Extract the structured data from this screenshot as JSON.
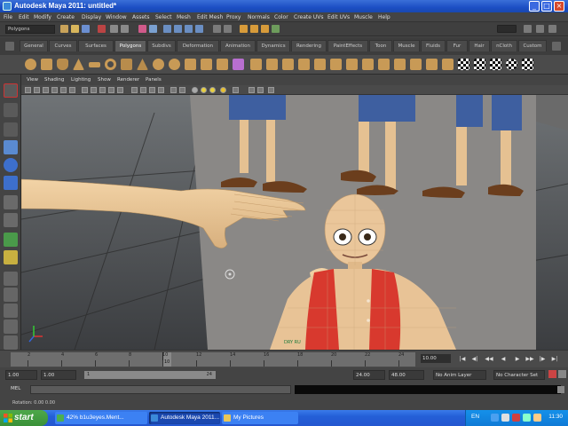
{
  "window": {
    "title": "Autodesk Maya 2011: untitled*"
  },
  "menubar": [
    "File",
    "Edit",
    "Modify",
    "Create",
    "Display",
    "Window",
    "Assets",
    "Select",
    "Mesh",
    "Edit Mesh",
    "Proxy",
    "Normals",
    "Color",
    "Create UVs",
    "Edit UVs",
    "Muscle",
    "Help"
  ],
  "status_line": {
    "mode": "Polygons"
  },
  "shelf_tabs": {
    "items": [
      "General",
      "Curves",
      "Surfaces",
      "Polygons",
      "Subdivs",
      "Deformation",
      "Animation",
      "Dynamics",
      "Rendering",
      "PaintEffects",
      "Toon",
      "Muscle",
      "Fluids",
      "Fur",
      "Hair",
      "nCloth",
      "Custom"
    ],
    "active": "Polygons"
  },
  "panel_menu": [
    "View",
    "Shading",
    "Lighting",
    "Show",
    "Renderer",
    "Panels"
  ],
  "viewport": {
    "mesh_label": "DRY RU"
  },
  "time_slider": {
    "tick_labels": [
      "2",
      "4",
      "6",
      "8",
      "10",
      "12",
      "14",
      "16",
      "18",
      "20",
      "22",
      "24"
    ],
    "current_frame_label": "10",
    "current_frame_field": "10.00",
    "playback_buttons": [
      "|◀",
      "◀|",
      "◀◀",
      "◀",
      "▶",
      "▶▶",
      "|▶",
      "▶|"
    ]
  },
  "range_slider": {
    "start_time": "1.00",
    "playback_start": "1.00",
    "range_start": "1",
    "range_end": "24",
    "playback_end": "24.00",
    "end_time": "48.00",
    "anim_layer": "No Anim Layer",
    "character_set": "No Character Set"
  },
  "command_line": {
    "label": "MEL"
  },
  "help_line": {
    "text": "Rotation:    0.00    0.00"
  },
  "taskbar": {
    "start_label": "start",
    "tasks": [
      {
        "label": "42% b1u3eyes.Ment...",
        "active": false
      },
      {
        "label": "Autodesk Maya 2011...",
        "active": true
      },
      {
        "label": "My Pictures",
        "active": false
      }
    ],
    "language": "EN",
    "clock": "11:30"
  },
  "colors": {
    "titlebar": "#245fd7",
    "maya_bg": "#444444",
    "viewport_bg": "#5a5a5a",
    "vest_red": "#d8392e",
    "skin": "#e9c79a",
    "jeans": "#3e5fa0"
  }
}
